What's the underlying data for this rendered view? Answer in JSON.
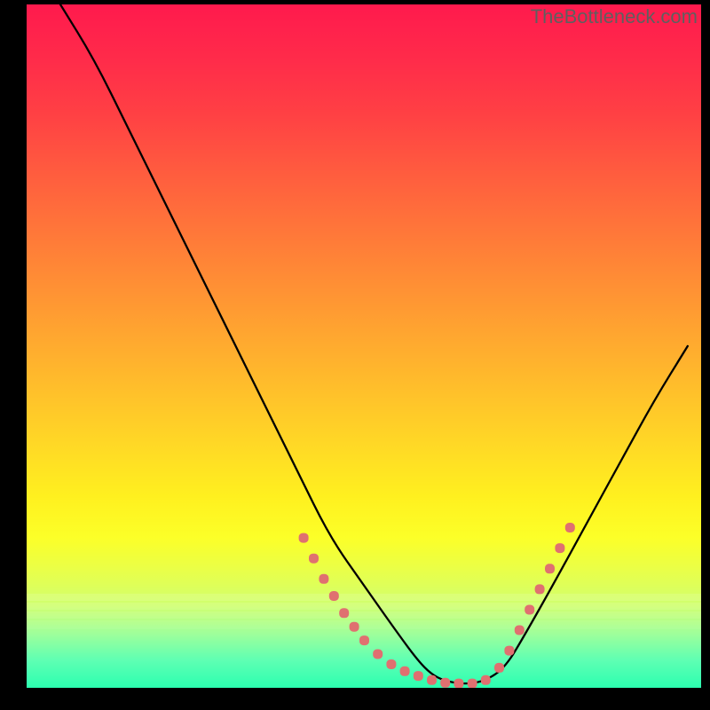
{
  "watermark": "TheBottleneck.com",
  "colors": {
    "gradient_top": "#ff1a4d",
    "gradient_bottom": "#2cffb0",
    "curve": "#000000",
    "dots": "#e07070",
    "bg": "#000000"
  },
  "chart_data": {
    "type": "line",
    "title": "",
    "xlabel": "",
    "ylabel": "",
    "xlim": [
      0,
      100
    ],
    "ylim": [
      0,
      100
    ],
    "grid": false,
    "series": [
      {
        "name": "curve",
        "x": [
          5,
          10,
          15,
          20,
          25,
          30,
          35,
          40,
          45,
          50,
          55,
          58,
          60,
          62,
          65,
          68,
          71,
          74,
          78,
          83,
          88,
          93,
          98
        ],
        "y": [
          100,
          92,
          82,
          72,
          62,
          52,
          42,
          32,
          22,
          15,
          8,
          4,
          2,
          1,
          0.5,
          1,
          3,
          8,
          15,
          24,
          33,
          42,
          50
        ]
      }
    ],
    "dots": {
      "name": "dotted-overlay",
      "x": [
        41,
        42.5,
        44,
        45.5,
        47,
        48.5,
        50,
        52,
        54,
        56,
        58,
        60,
        62,
        64,
        66,
        68,
        70,
        71.5,
        73,
        74.5,
        76,
        77.5,
        79,
        80.5
      ],
      "y": [
        22,
        19,
        16,
        13.5,
        11,
        9,
        7,
        5,
        3.5,
        2.5,
        1.8,
        1.2,
        0.8,
        0.7,
        0.7,
        1.2,
        3,
        5.5,
        8.5,
        11.5,
        14.5,
        17.5,
        20.5,
        23.5
      ]
    },
    "bottom_bands": [
      {
        "y0": 85.5,
        "y1": 86.5,
        "alpha": 0.12
      },
      {
        "y0": 86.5,
        "y1": 87.5,
        "alpha": 0.1
      },
      {
        "y0": 87.5,
        "y1": 88.5,
        "alpha": 0.08
      },
      {
        "y0": 88.5,
        "y1": 90.0,
        "alpha": 0.06
      }
    ]
  }
}
